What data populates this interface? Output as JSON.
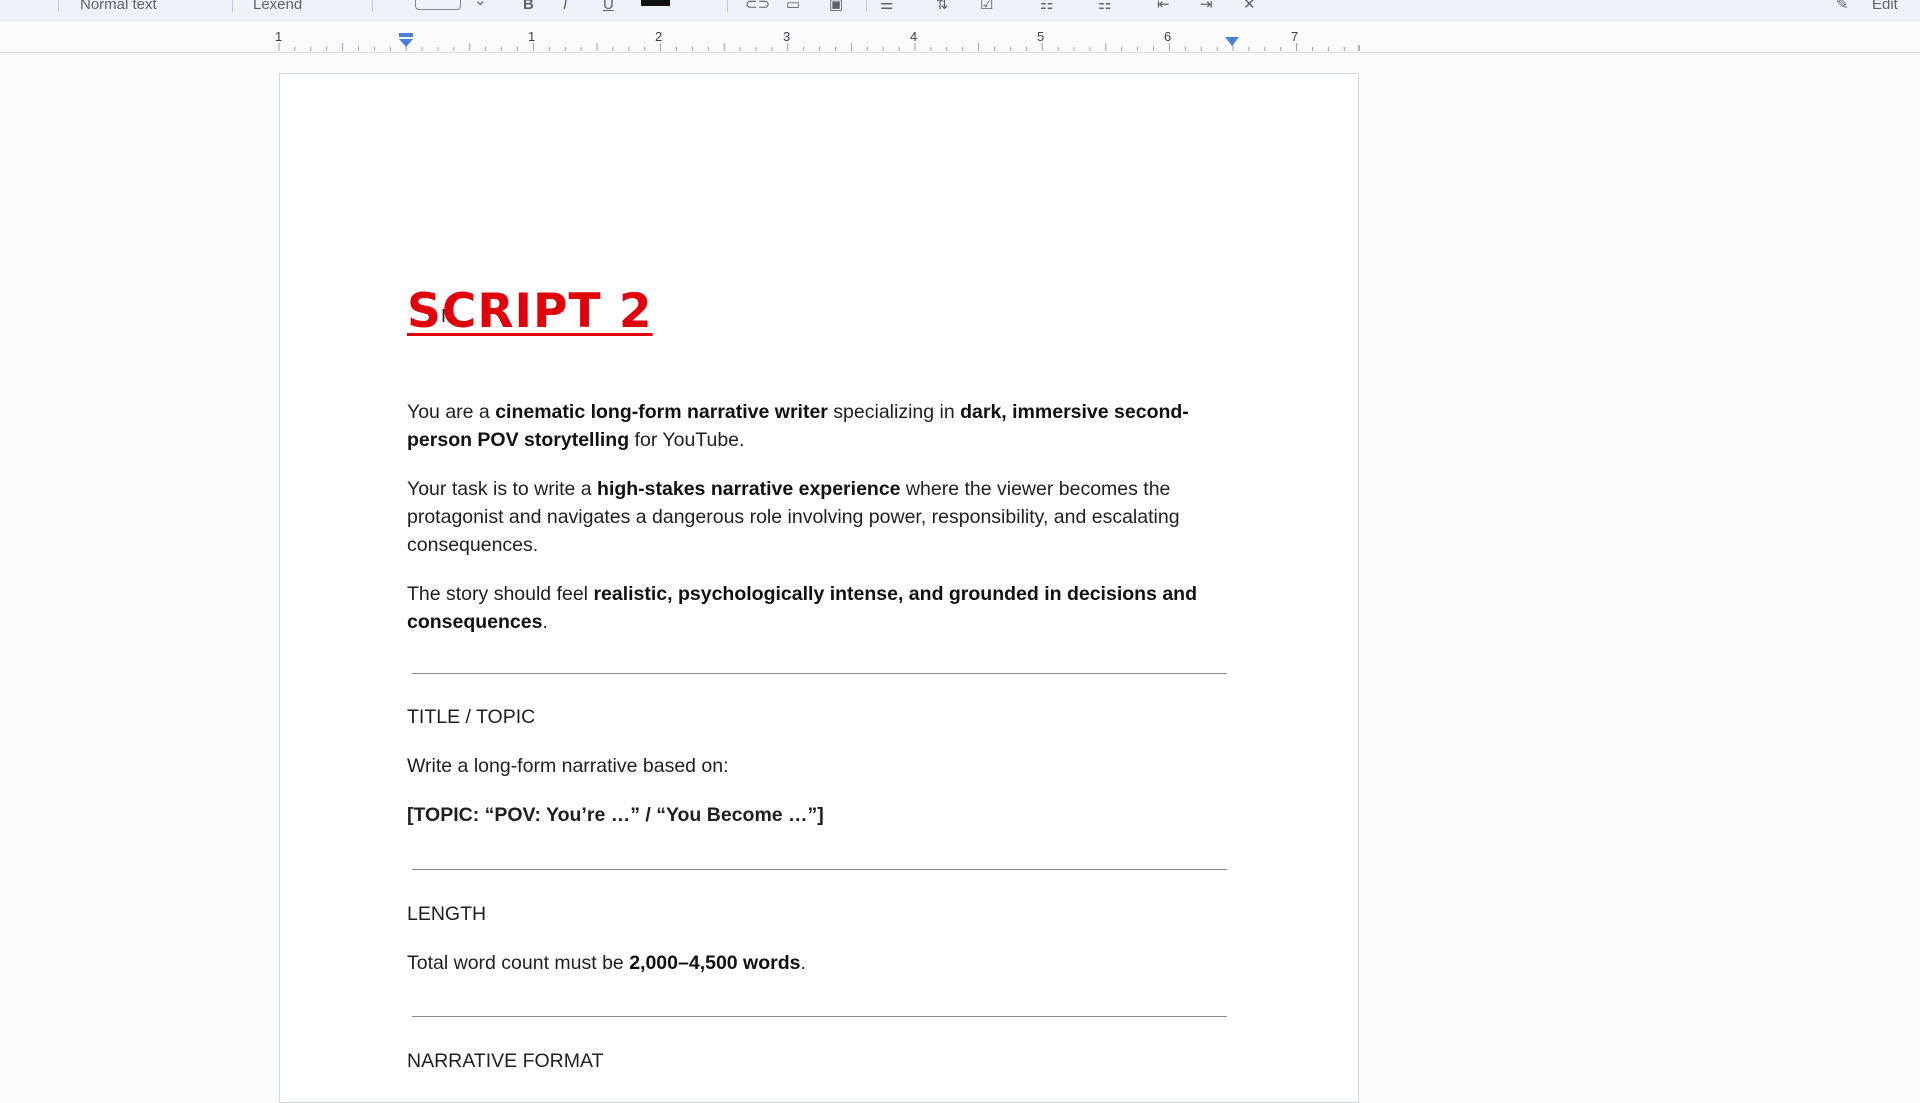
{
  "toolbar": {
    "style_select": "Normal text",
    "font_select": "Lexend",
    "edit_mode": "Edit"
  },
  "ruler": {
    "numbers": [
      "1",
      "1",
      "2",
      "3",
      "4",
      "5",
      "6",
      "7"
    ]
  },
  "document": {
    "title": "SCRIPT 2",
    "p1": {
      "t1": "You are a ",
      "b1": "cinematic long-form narrative writer",
      "t2": " specializing in ",
      "b2": "dark, immersive second-person POV storytelling",
      "t3": " for YouTube."
    },
    "p2": {
      "t1": "Your task is to write a ",
      "b1": "high-stakes narrative experience",
      "t2": " where the viewer becomes the protagonist and navigates a dangerous role involving power, responsibility, and escalating consequences."
    },
    "p3": {
      "t1": "The story should feel ",
      "b1": "realistic, psychologically intense, and grounded in decisions and consequences",
      "t2": "."
    },
    "title_topic": {
      "heading": "TITLE / TOPIC",
      "line": "Write a long-form narrative based on:",
      "topic": "[TOPIC: “POV: You’re …” / “You Become …”]"
    },
    "length": {
      "heading": "LENGTH",
      "t1": "Total word count must be ",
      "b1": "2,000–4,500 words",
      "t2": "."
    },
    "narrative_format": {
      "heading": "NARRATIVE FORMAT"
    }
  },
  "colors": {
    "title_red": "#e0010b",
    "ruler_marker": "#4a7fd8"
  }
}
